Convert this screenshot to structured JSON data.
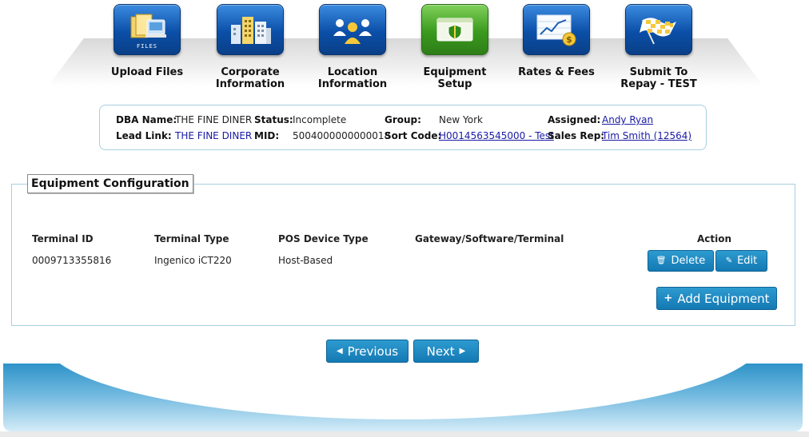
{
  "steps": [
    {
      "label": "Upload Files",
      "icon": "upload-files-icon",
      "badge": "FILES"
    },
    {
      "label": "Corporate Information",
      "icon": "corporate-building-icon"
    },
    {
      "label": "Location Information",
      "icon": "location-people-icon"
    },
    {
      "label": "Equipment Setup",
      "icon": "equipment-terminal-icon",
      "active": true
    },
    {
      "label": "Rates & Fees",
      "icon": "rates-chart-icon"
    },
    {
      "label": "Submit To Repay - TEST",
      "icon": "checkered-flag-icon"
    }
  ],
  "merchant": {
    "dba_label": "DBA Name:",
    "dba_value": "THE FINE DINER",
    "status_label": "Status:",
    "status_value": "Incomplete",
    "group_label": "Group:",
    "group_value": "New York",
    "assigned_label": "Assigned:",
    "assigned_value": "Andy Ryan",
    "lead_label": "Lead Link:",
    "lead_value": "THE FINE DINER",
    "mid_label": "MID:",
    "mid_value": "5004000000000018",
    "sort_label": "Sort Code:",
    "sort_value": "H0014563545000 - Test",
    "rep_label": "Sales Rep:",
    "rep_value": "Tim Smith (12564)"
  },
  "equipment": {
    "title": "Equipment Configuration",
    "headers": {
      "terminal_id": "Terminal ID",
      "terminal_type": "Terminal Type",
      "pos_type": "POS Device Type",
      "gateway": "Gateway/Software/Terminal",
      "action": "Action"
    },
    "rows": [
      {
        "terminal_id": "0009713355816",
        "terminal_type": "Ingenico iCT220",
        "pos_type": "Host-Based",
        "gateway": ""
      }
    ],
    "delete_label": "Delete",
    "edit_label": "Edit",
    "add_label": "Add Equipment"
  },
  "nav": {
    "previous_label": "Previous",
    "next_label": "Next"
  },
  "colors": {
    "accent_blue": "#1479b3",
    "active_step_green": "#3a9a1e",
    "step_blue": "#0b4fa8",
    "link_blue": "#1a1aa6"
  }
}
